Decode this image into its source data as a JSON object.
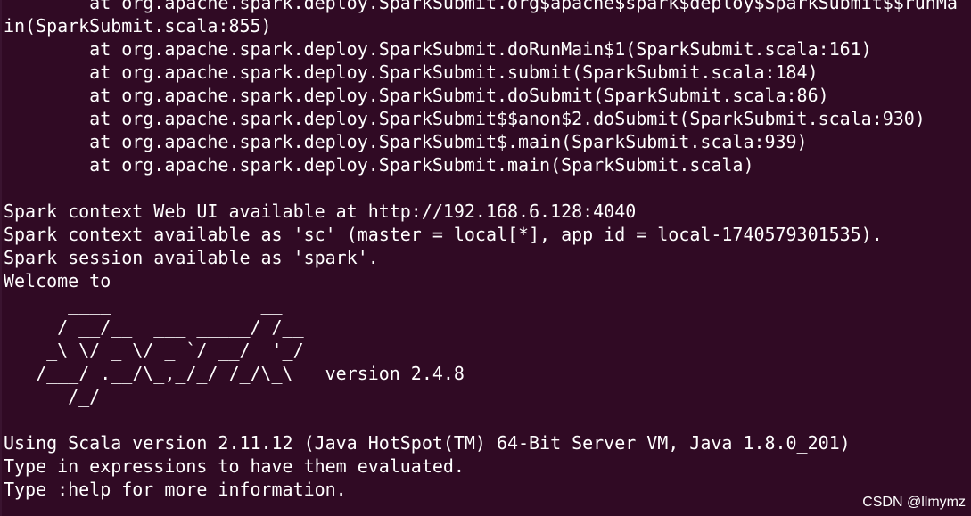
{
  "terminal": {
    "lines": [
      "        at org.apache.spark.deploy.SparkSubmit.org$apache$spark$deploy$SparkSubmit$$runMa",
      "in(SparkSubmit.scala:855)",
      "        at org.apache.spark.deploy.SparkSubmit.doRunMain$1(SparkSubmit.scala:161)",
      "        at org.apache.spark.deploy.SparkSubmit.submit(SparkSubmit.scala:184)",
      "        at org.apache.spark.deploy.SparkSubmit.doSubmit(SparkSubmit.scala:86)",
      "        at org.apache.spark.deploy.SparkSubmit$$anon$2.doSubmit(SparkSubmit.scala:930)",
      "        at org.apache.spark.deploy.SparkSubmit$.main(SparkSubmit.scala:939)",
      "        at org.apache.spark.deploy.SparkSubmit.main(SparkSubmit.scala)",
      "",
      "Spark context Web UI available at http://192.168.6.128:4040",
      "Spark context available as 'sc' (master = local[*], app id = local-1740579301535).",
      "Spark session available as 'spark'.",
      "Welcome to",
      "      ____              __",
      "     / __/__  ___ _____/ /__",
      "    _\\ \\/ _ \\/ _ `/ __/  '_/",
      "   /___/ .__/\\_,_/_/ /_/\\_\\   version 2.4.8",
      "      /_/",
      "",
      "Using Scala version 2.11.12 (Java HotSpot(TM) 64-Bit Server VM, Java 1.8.0_201)",
      "Type in expressions to have them evaluated.",
      "Type :help for more information."
    ]
  },
  "watermark": "CSDN @llmymz",
  "colors": {
    "background": "#300a24",
    "text": "#ffffff"
  }
}
